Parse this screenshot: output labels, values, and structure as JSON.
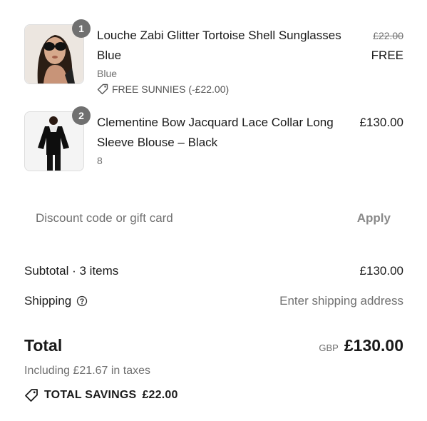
{
  "items": [
    {
      "quantity": "1",
      "title": "Louche Zabi Glitter Tortoise Shell Sunglasses Blue",
      "variant": "Blue",
      "discount": "FREE SUNNIES (-£22.00)",
      "original_price": "£22.00",
      "price": "FREE",
      "image_icon": "sunglasses-model-photo"
    },
    {
      "quantity": "2",
      "title": "Clementine Bow Jacquard Lace Collar Long Sleeve Blouse – Black",
      "variant": "8",
      "price": "£130.00",
      "image_icon": "blouse-model-photo"
    }
  ],
  "discount_code": {
    "placeholder": "Discount code or gift card",
    "value": "",
    "apply_label": "Apply"
  },
  "summary": {
    "subtotal_label": "Subtotal · 3 items",
    "subtotal_value": "£130.00",
    "shipping_label": "Shipping",
    "shipping_value": "Enter shipping address",
    "total_label": "Total",
    "currency": "GBP",
    "total_value": "£130.00",
    "taxes_note": "Including £21.67 in taxes",
    "savings_label": "TOTAL SAVINGS",
    "savings_value": "£22.00"
  }
}
